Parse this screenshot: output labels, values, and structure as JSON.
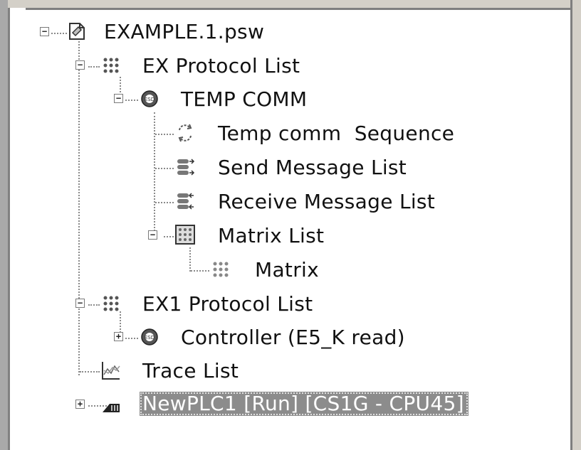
{
  "tree": {
    "root": {
      "label": "EXAMPLE.1.psw",
      "icon": "project-file-icon",
      "expander": "−"
    },
    "ex_protocol_list": {
      "label": "EX Protocol List",
      "icon": "protocol-list-icon",
      "expander": "−"
    },
    "temp_comm": {
      "label": "TEMP COMM",
      "icon": "protocol-icon",
      "expander": "−"
    },
    "temp_comm_sequence": {
      "label": "Temp comm  Sequence",
      "icon": "sequence-icon"
    },
    "send_message_list": {
      "label": "Send Message List",
      "icon": "send-message-icon"
    },
    "receive_message_list": {
      "label": "Receive Message List",
      "icon": "receive-message-icon"
    },
    "matrix_list": {
      "label": "Matrix List",
      "icon": "matrix-list-icon",
      "expander": "−"
    },
    "matrix": {
      "label": "Matrix",
      "icon": "matrix-icon"
    },
    "ex1_protocol_list": {
      "label": "EX1 Protocol List",
      "icon": "protocol-list-icon",
      "expander": "−"
    },
    "controller": {
      "label": "Controller (E5_K read)",
      "icon": "protocol-icon",
      "expander": "+"
    },
    "trace_list": {
      "label": "Trace List",
      "icon": "trace-icon"
    },
    "new_plc": {
      "label": "NewPLC1 [Run] [CS1G - CPU45]",
      "icon": "plc-icon",
      "expander": "+",
      "selected": true
    }
  }
}
